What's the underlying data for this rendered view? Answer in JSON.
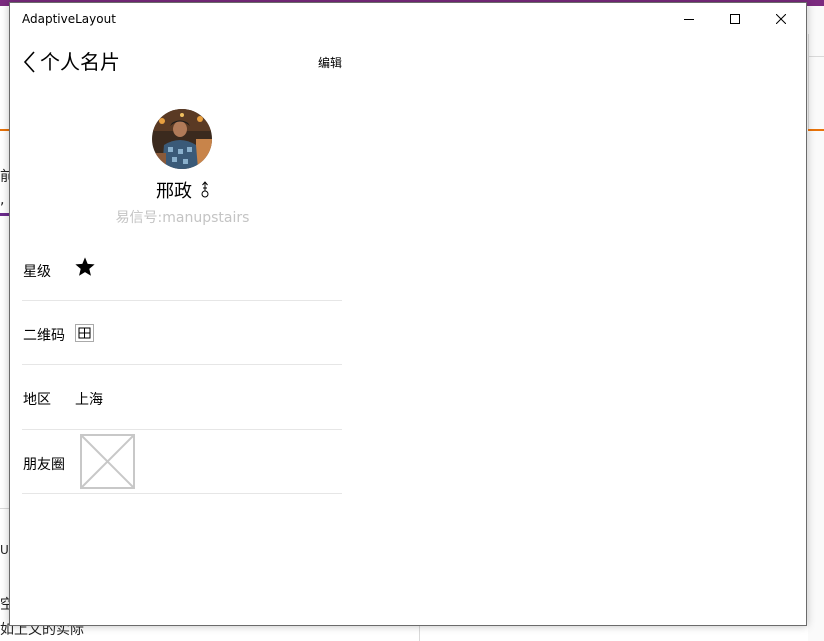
{
  "window": {
    "title": "AdaptiveLayout"
  },
  "header": {
    "back_icon": "chevron-left-icon",
    "title": "个人名片",
    "edit_label": "编辑"
  },
  "profile": {
    "name": "邢政",
    "gender_icon": "male-symbol-icon",
    "wechat_id": "易信号:manupstairs"
  },
  "rows": [
    {
      "label": "星级",
      "value_icon": "star-icon"
    },
    {
      "label": "二维码",
      "value_icon": "qr-code-icon"
    },
    {
      "label": "地区",
      "value": "上海"
    },
    {
      "label": "朋友圈",
      "value_icon": "image-placeholder-icon"
    }
  ],
  "background": {
    "fragments": [
      "前",
      ",",
      "UI",
      "空",
      "如上文的实际"
    ]
  },
  "colors": {
    "accent_purple": "#7b2a7f",
    "orange_line": "#e8730a",
    "divider": "#e6e6e6",
    "muted_text": "#c4c4c4"
  }
}
